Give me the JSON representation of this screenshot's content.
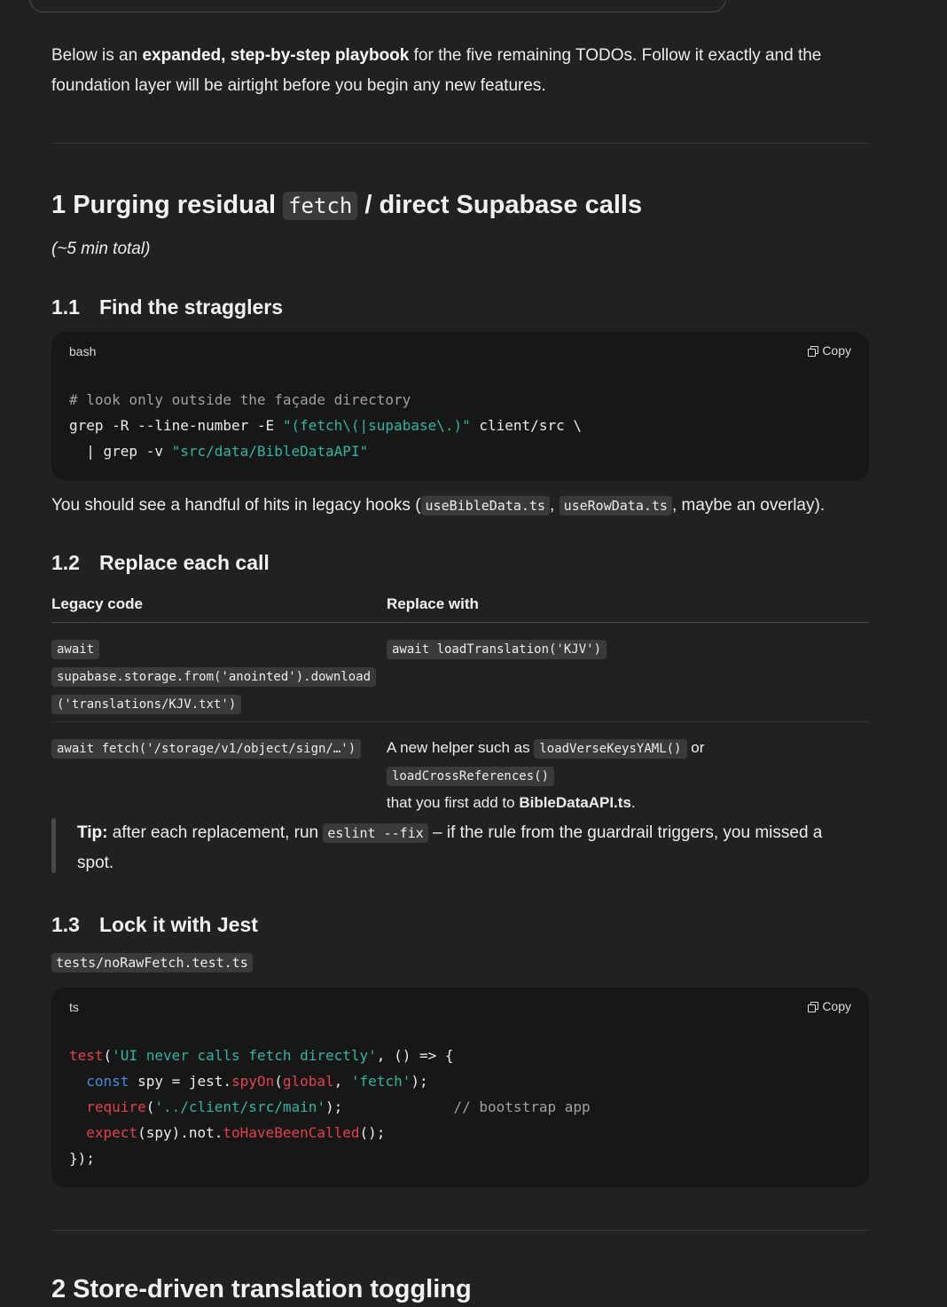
{
  "intro": {
    "pre": "Below is an ",
    "bold": "expanded, step-by-step playbook",
    "post": " for the five remaining TODOs. Follow it exactly and the foundation layer will be airtight before you begin any new features."
  },
  "section1": {
    "title_num": "1",
    "title_pre": "Purging residual",
    "title_code": "fetch",
    "title_post": "/ direct Supabase calls",
    "duration": "(~5 min total)"
  },
  "step_1_1": {
    "num": "1.1",
    "title": "Find the stragglers",
    "code": {
      "lang": "bash",
      "copy_label": "Copy",
      "lines": [
        [
          {
            "t": "# look only outside the façade directory",
            "c": "comment"
          }
        ],
        [
          {
            "t": "grep -R --line-number -E ",
            "c": "plain"
          },
          {
            "t": "\"(fetch\\(|supabase\\.)\"",
            "c": "string"
          },
          {
            "t": " client/src \\",
            "c": "plain"
          }
        ],
        [
          {
            "t": "  | grep -v ",
            "c": "plain"
          },
          {
            "t": "\"src/data/BibleDataAPI\"",
            "c": "string"
          }
        ]
      ]
    },
    "after_pre": "You should see a handful of hits in legacy hooks (",
    "after_code1": "useBibleData.ts",
    "after_mid": ",",
    "after_code2": "useRowData.ts",
    "after_post": ", maybe an overlay)."
  },
  "step_1_2": {
    "num": "1.2",
    "title": "Replace each call",
    "table": {
      "headers": [
        "Legacy code",
        "Replace with"
      ],
      "row1": {
        "legacy_lines": [
          "await",
          "supabase.storage.from('anointed').download",
          "('translations/KJV.txt')"
        ],
        "replace": "await loadTranslation('KJV')"
      },
      "row2": {
        "legacy": "await fetch('/storage/v1/object/sign/…')",
        "replace_pre": "A new helper such as",
        "replace_code1": "loadVerseKeysYAML()",
        "replace_mid": "or",
        "replace_code2": "loadCrossReferences()",
        "replace_line2_pre": "that you first add to ",
        "replace_line2_bold": "BibleDataAPI.ts",
        "replace_line2_post": "."
      }
    },
    "tip": {
      "label": "Tip:",
      "pre": " after each replacement, run ",
      "code": "eslint --fix",
      "post": " – if the rule from the guardrail triggers, you missed a spot."
    }
  },
  "step_1_3": {
    "num": "1.3",
    "title": "Lock it with Jest",
    "file": "tests/noRawFetch.test.ts",
    "code": {
      "lang": "ts",
      "copy_label": "Copy",
      "lines": [
        [
          {
            "t": "test",
            "c": "fn"
          },
          {
            "t": "(",
            "c": "plain"
          },
          {
            "t": "'UI never calls fetch directly'",
            "c": "string"
          },
          {
            "t": ", () => {",
            "c": "plain"
          }
        ],
        [
          {
            "t": "  ",
            "c": "plain"
          },
          {
            "t": "const",
            "c": "kw"
          },
          {
            "t": " spy = jest.",
            "c": "plain"
          },
          {
            "t": "spyOn",
            "c": "fn"
          },
          {
            "t": "(",
            "c": "plain"
          },
          {
            "t": "global",
            "c": "fn"
          },
          {
            "t": ", ",
            "c": "plain"
          },
          {
            "t": "'fetch'",
            "c": "string"
          },
          {
            "t": ");",
            "c": "plain"
          }
        ],
        [
          {
            "t": "  ",
            "c": "plain"
          },
          {
            "t": "require",
            "c": "fn"
          },
          {
            "t": "(",
            "c": "plain"
          },
          {
            "t": "'../client/src/main'",
            "c": "string"
          },
          {
            "t": ");             ",
            "c": "plain"
          },
          {
            "t": "// bootstrap app",
            "c": "comment"
          }
        ],
        [
          {
            "t": "  ",
            "c": "plain"
          },
          {
            "t": "expect",
            "c": "fn"
          },
          {
            "t": "(spy).not.",
            "c": "plain"
          },
          {
            "t": "toHaveBeenCalled",
            "c": "fn"
          },
          {
            "t": "();",
            "c": "plain"
          }
        ],
        [
          {
            "t": "});",
            "c": "plain"
          }
        ]
      ]
    }
  },
  "section2": {
    "title": "2 Store-driven translation toggling"
  }
}
